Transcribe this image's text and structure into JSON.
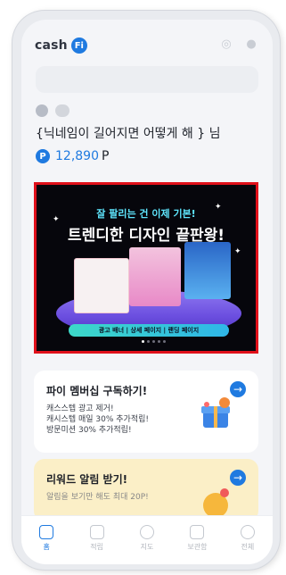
{
  "header": {
    "logo_text": "cash",
    "logo_badge": "Fi",
    "icons": [
      "bell-ring-icon",
      "bell-icon"
    ]
  },
  "profile": {
    "grade_label": "",
    "nickname": "{닉네임이 길어지면 어떻게 해 } 님",
    "points_symbol": "P",
    "points_value": "12,890",
    "points_unit": "P"
  },
  "banner": {
    "headline": "잘 팔리는 건 이제 기본!",
    "title": "트렌디한 디자인 끝판왕!",
    "footer": "광고 배너 | 상세 페이지 | 랜딩 페이지",
    "card1_text": "",
    "card2_text": "",
    "card3_text": ""
  },
  "membership": {
    "title": "파이 멤버십 구독하기!",
    "desc1": "캐스스텝 광고 제거!",
    "desc2": "캐시스텝 매일 30% 추가적립!",
    "desc3": "방문미션 30% 추가적립!"
  },
  "reward": {
    "title": "리워드 알림 받기!",
    "desc": "알림을 보기만 해도 최대 20P!"
  },
  "tabs": [
    {
      "label": "홈",
      "icon": "home-icon",
      "active": true
    },
    {
      "label": "적립",
      "icon": "star-icon",
      "active": false
    },
    {
      "label": "지도",
      "icon": "map-pin-icon",
      "active": false
    },
    {
      "label": "보관함",
      "icon": "basket-icon",
      "active": false
    },
    {
      "label": "전체",
      "icon": "more-icon",
      "active": false
    }
  ],
  "colors": {
    "brand": "#1f7ae0",
    "banner_border": "#e0101a",
    "reward_bg": "#fbefc7"
  }
}
